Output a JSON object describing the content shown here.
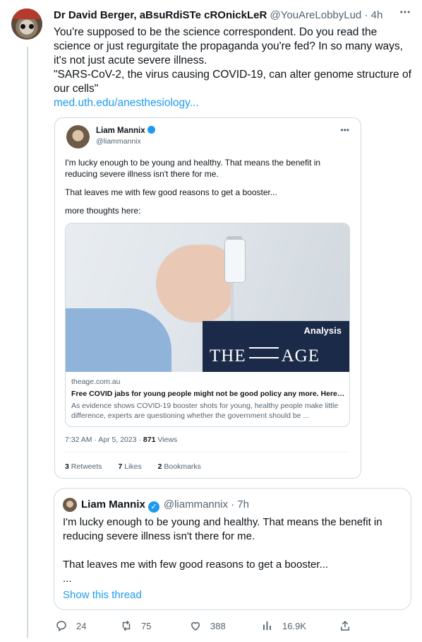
{
  "tweet": {
    "author_name": "Dr David Berger, aBsuRdiSTe cROnickLeR",
    "author_handle": "@YouAreLobbyLud",
    "time": "4h",
    "text_lines": [
      "You're supposed to be the science correspondent. Do you read the science or just regurgitate the propaganda you're fed? In so many ways, it's not just acute severe illness.",
      "\"SARS-CoV-2, the virus causing COVID-19, can alter genome structure of our cells\""
    ],
    "link": "med.uth.edu/anesthesiology..."
  },
  "screenshot": {
    "name": "Liam Mannix",
    "handle": "@liammannix",
    "text": [
      "I'm lucky enough to be young and healthy. That means the benefit in reducing severe illness isn't there for me.",
      "That leaves me with few good reasons to get a booster...",
      "more thoughts here:"
    ],
    "card": {
      "badge_label": "Analysis",
      "masthead_left": "THE",
      "masthead_right": "AGE",
      "domain": "theage.com.au",
      "title": "Free COVID jabs for young people might not be good policy any more. Here's ...",
      "description": "As evidence shows COVID-19 booster shots for young, healthy people make little difference, experts are questioning whether the government should be ..."
    },
    "meta_time": "7:32 AM · Apr 5, 2023 · ",
    "meta_views": "871",
    "meta_views_label": " Views",
    "retweets": "3",
    "retweets_label": " Retweets",
    "likes": "7",
    "likes_label": " Likes",
    "bookmarks": "2",
    "bookmarks_label": " Bookmarks"
  },
  "quote": {
    "name": "Liam Mannix",
    "handle": "@liammannix · 7h",
    "text": [
      "I'm lucky enough to be young and healthy. That means the benefit in reducing severe illness isn't there for me.",
      "",
      "That leaves me with few good reasons to get a booster...",
      "..."
    ],
    "show_thread": "Show this thread"
  },
  "actions": {
    "replies": "24",
    "retweets": "75",
    "likes": "388",
    "views": "16.9K"
  },
  "colors": {
    "accent": "#1d9bf0",
    "muted": "#536471",
    "border": "#cfd9de"
  }
}
